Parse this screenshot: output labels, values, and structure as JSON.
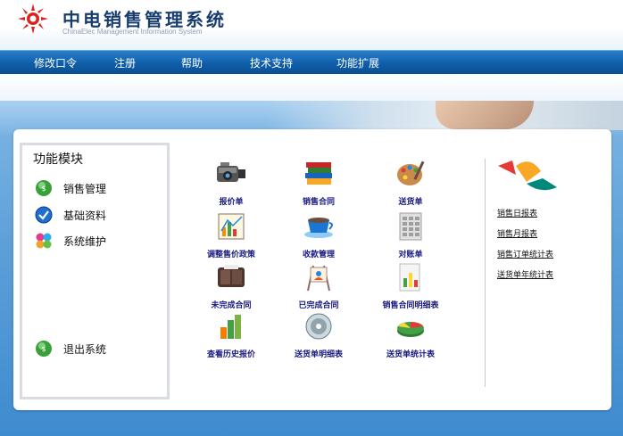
{
  "header": {
    "title": "中电销售管理系统",
    "subtitle": "ChinaElec Management Information System"
  },
  "nav": {
    "items": [
      "修改口令",
      "注册",
      "帮助",
      "技术支持",
      "功能扩展"
    ]
  },
  "sidebar": {
    "title": "功能模块",
    "items": [
      {
        "label": "销售管理",
        "icon": "sales-orb-icon"
      },
      {
        "label": "基础资料",
        "icon": "checkmark-icon"
      },
      {
        "label": "系统维护",
        "icon": "puzzle-icon"
      }
    ],
    "exit": {
      "label": "退出系统",
      "icon": "exit-orb-icon"
    }
  },
  "grid": {
    "items": [
      {
        "label": "报价单",
        "icon": "camera-icon"
      },
      {
        "label": "销售合同",
        "icon": "books-icon"
      },
      {
        "label": "送货单",
        "icon": "palette-icon"
      },
      {
        "label": "调整售价政策",
        "icon": "chart-icon"
      },
      {
        "label": "收款管理",
        "icon": "coffee-cup-icon"
      },
      {
        "label": "对账单",
        "icon": "calculator-icon"
      },
      {
        "label": "未完成合同",
        "icon": "wallet-icon"
      },
      {
        "label": "已完成合同",
        "icon": "easel-icon"
      },
      {
        "label": "销售合同明细表",
        "icon": "document-icon"
      },
      {
        "label": "查看历史报价",
        "icon": "bar-chart-icon"
      },
      {
        "label": "送货单明细表",
        "icon": "disc-icon"
      },
      {
        "label": "送货单统计表",
        "icon": "pie-chart-icon"
      }
    ]
  },
  "reports": {
    "items": [
      "销售日报表",
      "销售月报表",
      "销售订单统计表",
      "送货单年统计表"
    ]
  },
  "colors": {
    "nav_bg": "#0f5ea9",
    "link_text": "#1a1a80",
    "title_text": "#173d6e"
  }
}
